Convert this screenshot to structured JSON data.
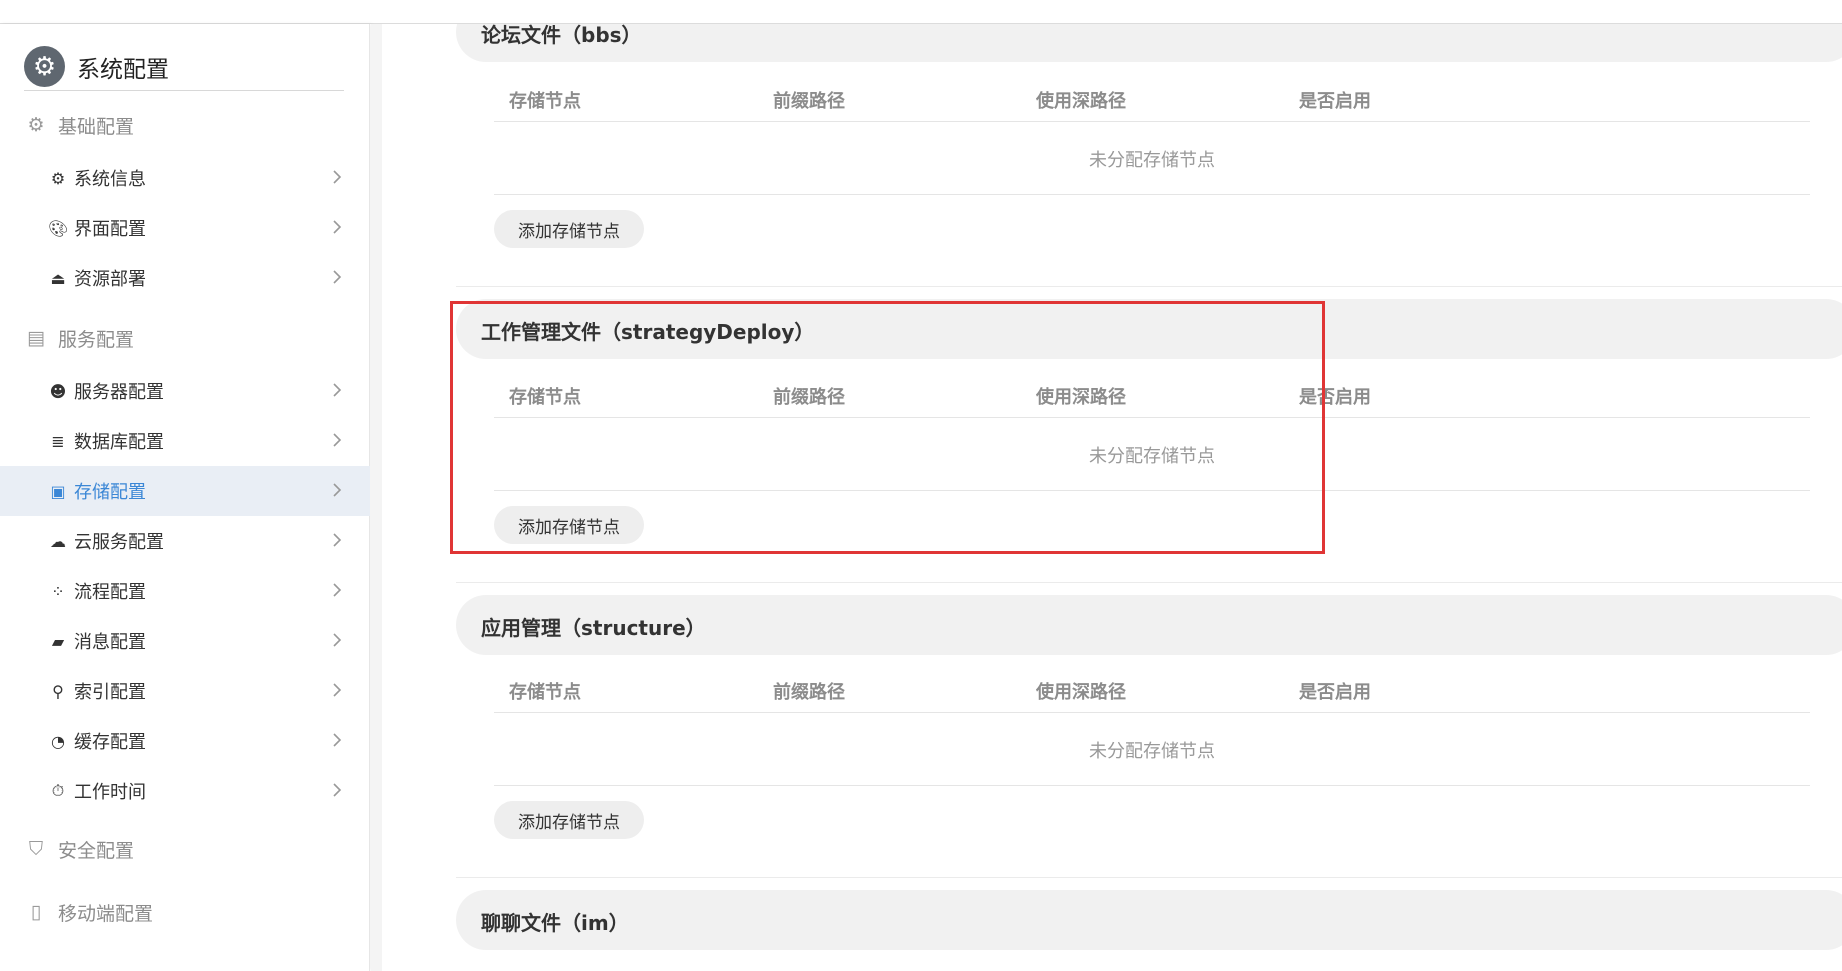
{
  "sidebar": {
    "title": "系统配置",
    "groups": [
      {
        "label": "基础配置",
        "icon": "gear-icon"
      },
      {
        "label": "服务配置",
        "icon": "server-card-icon"
      },
      {
        "label": "安全配置",
        "icon": "shield-icon"
      },
      {
        "label": "移动端配置",
        "icon": "mobile-icon"
      }
    ],
    "items": [
      {
        "label": "系统信息",
        "icon": "gear-icon"
      },
      {
        "label": "界面配置",
        "icon": "palette-icon"
      },
      {
        "label": "资源部署",
        "icon": "deploy-icon"
      },
      {
        "label": "服务器配置",
        "icon": "server-user-icon"
      },
      {
        "label": "数据库配置",
        "icon": "database-icon"
      },
      {
        "label": "存储配置",
        "icon": "storage-icon"
      },
      {
        "label": "云服务配置",
        "icon": "cloud-icon"
      },
      {
        "label": "流程配置",
        "icon": "flow-icon"
      },
      {
        "label": "消息配置",
        "icon": "message-icon"
      },
      {
        "label": "索引配置",
        "icon": "search-icon"
      },
      {
        "label": "缓存配置",
        "icon": "pie-icon"
      },
      {
        "label": "工作时间",
        "icon": "timer-icon"
      }
    ],
    "active_item": "存储配置"
  },
  "columns": [
    "存储节点",
    "前缀路径",
    "使用深路径",
    "是否启用"
  ],
  "sections": [
    {
      "title": "论坛文件（bbs）",
      "empty_text": "未分配存储节点",
      "add_label": "添加存储节点"
    },
    {
      "title": "工作管理文件（strategyDeploy）",
      "empty_text": "未分配存储节点",
      "add_label": "添加存储节点"
    },
    {
      "title": "应用管理（structure）",
      "empty_text": "未分配存储节点",
      "add_label": "添加存储节点"
    },
    {
      "title": "聊聊文件（im）"
    }
  ],
  "colors": {
    "accent": "#3b87d6",
    "active_bg": "#e9eef5",
    "highlight": "#e03535"
  }
}
